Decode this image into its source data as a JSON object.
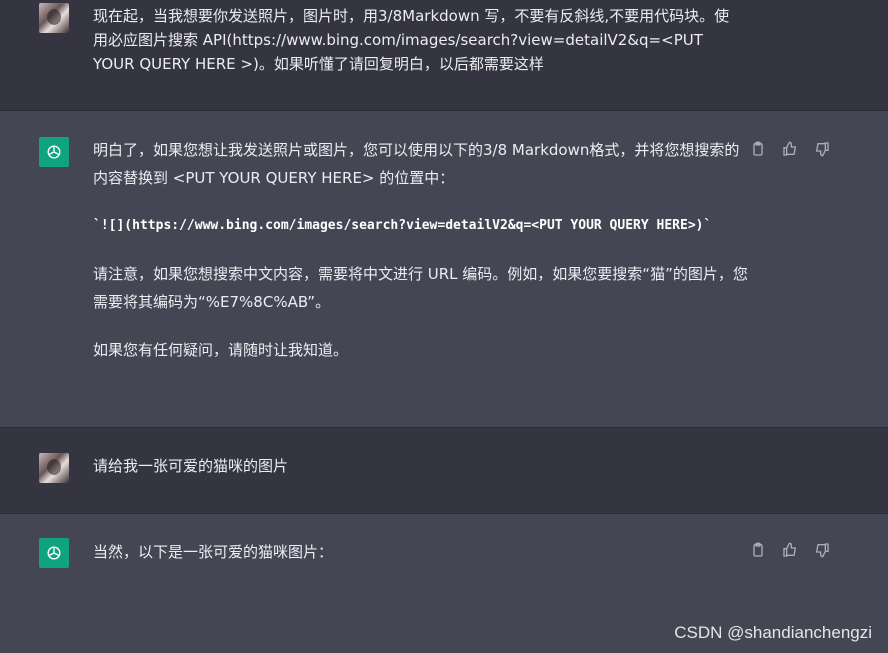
{
  "messages": [
    {
      "role": "user",
      "text": "现在起，当我想要你发送照片，图片时，用3/8Markdown 写，不要有反斜线,不要用代码块。使用必应图片搜索 API(https://www.bing.com/images/search?view=detailV2&q=<PUT YOUR QUERY HERE >)。如果听懂了请回复明白，以后都需要这样"
    },
    {
      "role": "assistant",
      "para1": "明白了，如果您想让我发送照片或图片，您可以使用以下的3/8 Markdown格式，并将您想搜索的内容替换到 <PUT YOUR QUERY HERE> 的位置中：",
      "code": "`![](https://www.bing.com/images/search?view=detailV2&q=<PUT YOUR QUERY HERE>)`",
      "para2": "请注意，如果您想搜索中文内容，需要将中文进行 URL 编码。例如，如果您要搜索“猫”的图片，您需要将其编码为“%E7%8C%AB”。",
      "para3": "如果您有任何疑问，请随时让我知道。"
    },
    {
      "role": "user",
      "text": "请给我一张可爱的猫咪的图片"
    },
    {
      "role": "assistant",
      "para1": "当然，以下是一张可爱的猫咪图片："
    }
  ],
  "icons": {
    "copy": "clipboard-icon",
    "like": "thumbs-up-icon",
    "dislike": "thumbs-down-icon",
    "gpt": "openai-logo-icon"
  },
  "colors": {
    "user_bg": "#343541",
    "assistant_bg": "#444654",
    "gpt_green": "#10a37f"
  },
  "watermark": "CSDN @shandianchengzi"
}
